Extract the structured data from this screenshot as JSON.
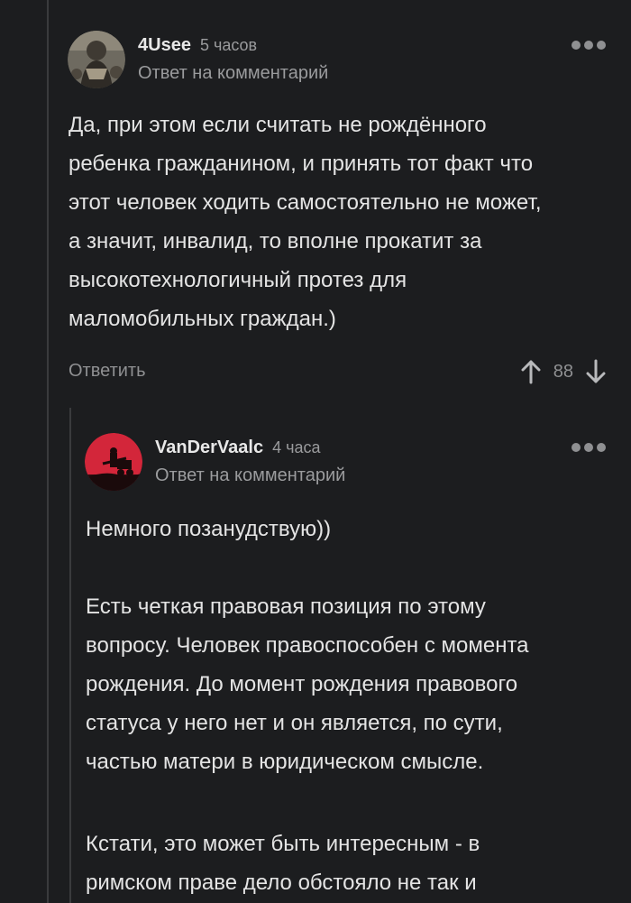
{
  "comment1": {
    "username": "4Usee",
    "timestamp": "5 часов",
    "reply_label": "Ответ на комментарий",
    "text_lines": [
      "Да, при этом если считать не рождённого",
      "ребенка гражданином, и принять тот факт что",
      "этот человек ходить самостоятельно не может,",
      "а значит, инвалид, то вполне прокатит за",
      "высокотехнологичный протез для",
      "маломобильных граждан.)"
    ],
    "reply_button": "Ответить",
    "rating": "88",
    "avatar_icon": "user-avatar",
    "upvote_icon": "arrow-up-icon",
    "downvote_icon": "arrow-down-icon",
    "more_icon": "more-dots-icon"
  },
  "comment2": {
    "username": "VanDerVaalc",
    "timestamp": "4 часа",
    "reply_label": "Ответ на комментарий",
    "paragraphs": [
      [
        "Немного позанудствую))"
      ],
      [
        "Есть четкая правовая позиция по этому",
        "вопросу. Человек правоспособен с момента",
        "рождения. До момент рождения правового",
        "статуса у него нет и он является, по сути,",
        "частью матери в юридическом смысле."
      ],
      [
        "Кстати, это может быть интересным - в",
        "римском праве дело обстояло не так и"
      ]
    ],
    "avatar_icon": "user-avatar",
    "more_icon": "more-dots-icon"
  },
  "colors": {
    "background": "#1c1d1f",
    "text": "#e4e4e4",
    "muted": "#9a9b9d",
    "thread_line": "#3a3b3d",
    "avatar2_red": "#d3263a"
  }
}
